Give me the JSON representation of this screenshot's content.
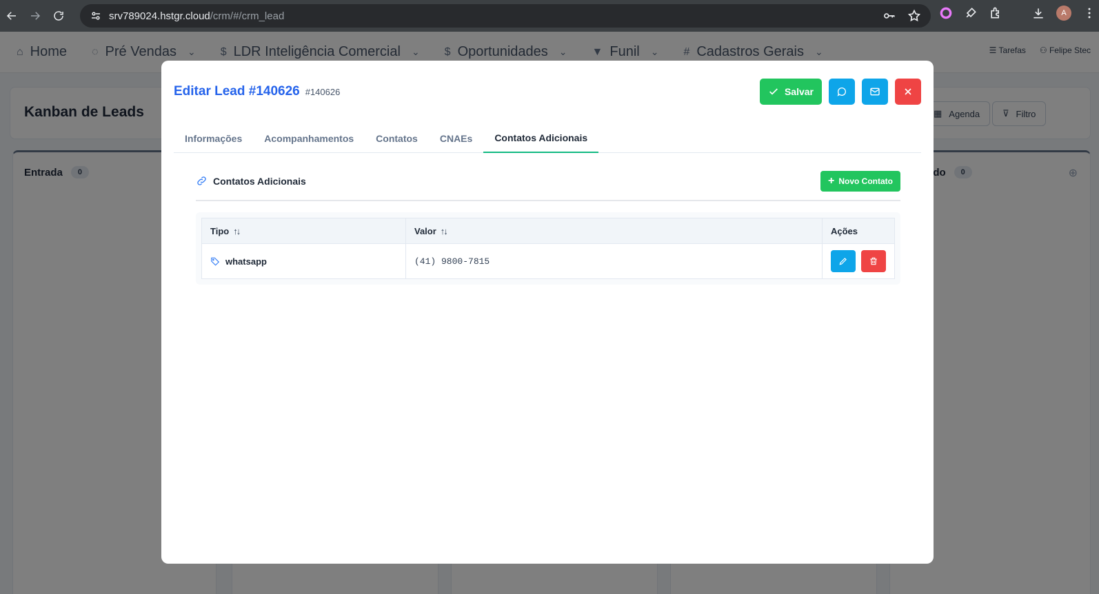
{
  "browser": {
    "url_host": "srv789024.hstgr.cloud",
    "url_path": "/crm/#/crm_lead",
    "profile_initial": "A"
  },
  "app_nav": {
    "items": [
      {
        "label": "Home",
        "icon": "home-icon"
      },
      {
        "label": "Pré Vendas",
        "icon": "chat-icon"
      },
      {
        "label": "LDR Inteligência Comercial",
        "icon": "dollar-icon"
      },
      {
        "label": "Oportunidades",
        "icon": "dollar-icon"
      },
      {
        "label": "Funil",
        "icon": "funnel-icon"
      },
      {
        "label": "Cadastros Gerais",
        "icon": "hash-icon"
      }
    ],
    "tasks_label": "Tarefas",
    "user_label": "Felipe Stec"
  },
  "kanban": {
    "title": "Kanban de Leads",
    "agenda_label": "Agenda",
    "filter_label": "Filtro",
    "columns": [
      {
        "title": "Entrada",
        "count": "0"
      },
      {
        "title": "ado",
        "count": "0"
      }
    ]
  },
  "modal": {
    "title": "Editar Lead #140626",
    "subtitle": "#140626",
    "save_label": "Salvar",
    "tabs": [
      "Informações",
      "Acompanhamentos",
      "Contatos",
      "CNAEs",
      "Contatos Adicionais"
    ],
    "active_tab": "Contatos Adicionais",
    "section_title": "Contatos Adicionais",
    "new_contact_label": "Novo Contato",
    "table": {
      "headers": {
        "tipo": "Tipo",
        "valor": "Valor",
        "acoes": "Ações"
      },
      "rows": [
        {
          "tipo": "whatsapp",
          "valor": "(41) 9800-7815"
        }
      ]
    }
  },
  "colors": {
    "primary_blue": "#2563eb",
    "success_green": "#22c55e",
    "info_blue": "#0ea5e9",
    "danger_red": "#ef4444",
    "tab_underline": "#10b981"
  }
}
